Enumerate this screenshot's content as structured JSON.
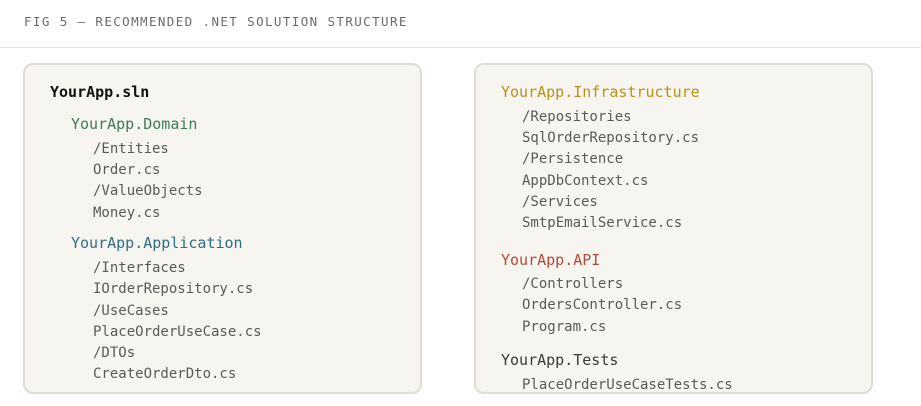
{
  "caption": "FIG 5 — RECOMMENDED .NET SOLUTION STRUCTURE",
  "colors": {
    "domain": "#3f7a55",
    "application": "#2f6e82",
    "infrastructure": "#b8901c",
    "api": "#b4493a",
    "tests": "#3a3a3a"
  },
  "left_panel": {
    "solution": "YourApp.sln",
    "domain": {
      "name": "YourApp.Domain",
      "items": [
        "/Entities",
        "Order.cs",
        "/ValueObjects",
        "Money.cs"
      ]
    },
    "application": {
      "name": "YourApp.Application",
      "items": [
        "/Interfaces",
        "IOrderRepository.cs",
        "/UseCases",
        "PlaceOrderUseCase.cs",
        "/DTOs",
        "CreateOrderDto.cs"
      ]
    }
  },
  "right_panel": {
    "infrastructure": {
      "name": "YourApp.Infrastructure",
      "items": [
        "/Repositories",
        "SqlOrderRepository.cs",
        "/Persistence",
        "AppDbContext.cs",
        "/Services",
        "SmtpEmailService.cs"
      ]
    },
    "api": {
      "name": "YourApp.API",
      "items": [
        "/Controllers",
        "OrdersController.cs",
        "Program.cs"
      ]
    },
    "tests": {
      "name": "YourApp.Tests",
      "items": [
        "PlaceOrderUseCaseTests.cs"
      ]
    }
  }
}
